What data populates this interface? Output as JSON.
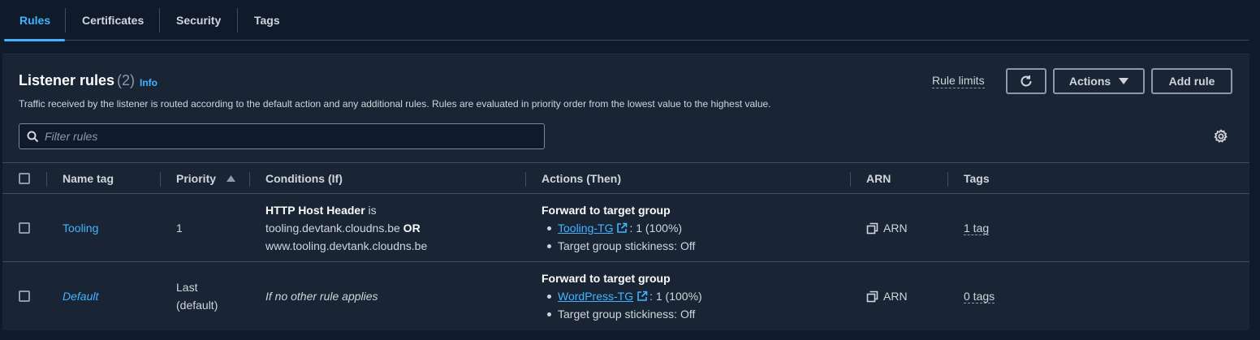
{
  "tabs": [
    {
      "label": "Rules",
      "active": true
    },
    {
      "label": "Certificates",
      "active": false
    },
    {
      "label": "Security",
      "active": false
    },
    {
      "label": "Tags",
      "active": false
    }
  ],
  "panel": {
    "title": "Listener rules",
    "count": "(2)",
    "info": "Info",
    "description": "Traffic received by the listener is routed according to the default action and any additional rules. Rules are evaluated in priority order from the lowest value to the highest value.",
    "rule_limits": "Rule limits",
    "actions_label": "Actions",
    "add_rule_label": "Add rule",
    "filter_placeholder": "Filter rules"
  },
  "table": {
    "columns": [
      "Name tag",
      "Priority",
      "Conditions (If)",
      "Actions (Then)",
      "ARN",
      "Tags"
    ],
    "rows": [
      {
        "name": "Tooling",
        "priority_line1": "1",
        "priority_line2": "",
        "condition_header": "HTTP Host Header",
        "condition_is": " is",
        "condition_value1": "tooling.devtank.cloudns.be",
        "condition_or": " OR",
        "condition_value2": "www.tooling.devtank.cloudns.be",
        "action_title": "Forward to target group",
        "target_group": "Tooling-TG",
        "target_weight": ": 1 (100%)",
        "stickiness": "Target group stickiness: Off",
        "arn": "ARN",
        "tags": "1 tag"
      },
      {
        "name": "Default",
        "priority_line1": "Last",
        "priority_line2": "(default)",
        "condition_text": "If no other rule applies",
        "action_title": "Forward to target group",
        "target_group": "WordPress-TG",
        "target_weight": ": 1 (100%)",
        "stickiness": "Target group stickiness: Off",
        "arn": "ARN",
        "tags": "0 tags"
      }
    ]
  },
  "colors": {
    "accent": "#42b4ff",
    "background": "#0f1b2a",
    "panel": "#192534",
    "border": "#414d5c"
  }
}
